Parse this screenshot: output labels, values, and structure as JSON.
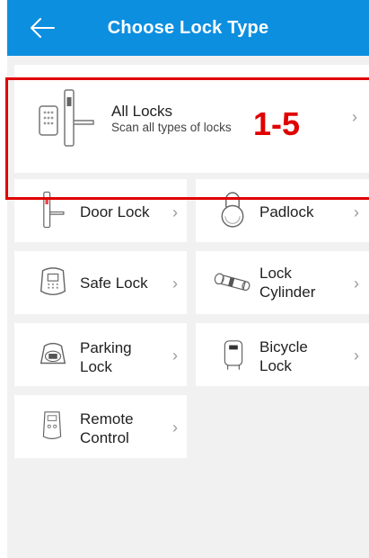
{
  "header": {
    "title": "Choose Lock Type"
  },
  "all_locks": {
    "title": "All Locks",
    "subtitle": "Scan all types of locks"
  },
  "types": [
    {
      "label": "Door Lock"
    },
    {
      "label": "Padlock"
    },
    {
      "label": "Safe Lock"
    },
    {
      "label": "Lock\nCylinder"
    },
    {
      "label": "Parking\nLock"
    },
    {
      "label": "Bicycle\nLock"
    },
    {
      "label": "Remote\nControl"
    }
  ],
  "annotation": {
    "text": "1-5"
  },
  "chevron": "›",
  "colors": {
    "header": "#0d8fe0",
    "highlight": "#e00000",
    "background": "#f1f1f1"
  }
}
